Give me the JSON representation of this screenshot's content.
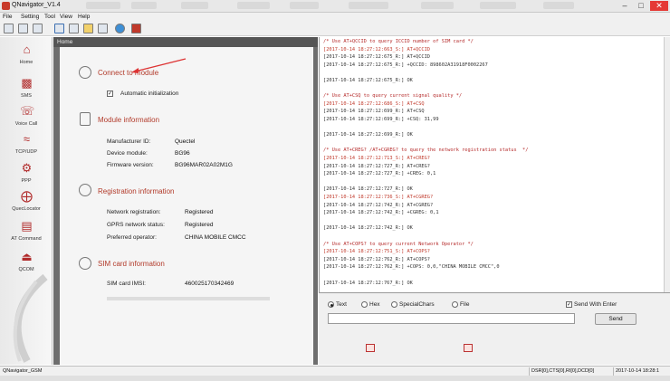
{
  "window": {
    "title": "QNavigator_V1.4"
  },
  "menu": [
    "File",
    "Setting",
    "Tool",
    "View",
    "Help"
  ],
  "sidebar": {
    "items": [
      {
        "label": "Home",
        "icon": "home-icon"
      },
      {
        "label": "SMS",
        "icon": "sms-icon"
      },
      {
        "label": "Voice Call",
        "icon": "phone-icon"
      },
      {
        "label": "TCP/UDP",
        "icon": "wifi-icon"
      },
      {
        "label": "PPP",
        "icon": "ppp-icon"
      },
      {
        "label": "QuecLocator",
        "icon": "locator-icon"
      },
      {
        "label": "AT Command",
        "icon": "at-command-icon"
      },
      {
        "label": "QCOM",
        "icon": "qcom-icon"
      }
    ]
  },
  "home": {
    "header": "Home",
    "connect": {
      "title": "Connect to module",
      "auto_init_label": "Automatic initialization",
      "auto_init": true
    },
    "module_info": {
      "title": "Module information",
      "rows": [
        {
          "label": "Manufacturer ID:",
          "value": "Quectel"
        },
        {
          "label": "Device module:",
          "value": "BG96"
        },
        {
          "label": "Firmware version:",
          "value": "BG96MAR02A02M1G"
        }
      ]
    },
    "registration": {
      "title": "Registration information",
      "rows": [
        {
          "label": "Network registration:",
          "value": "Registered"
        },
        {
          "label": "GPRS network status:",
          "value": "Registered"
        },
        {
          "label": "Preferred operator:",
          "value": "CHINA MOBILE CMCC"
        }
      ]
    },
    "sim": {
      "title": "SIM card information",
      "rows": [
        {
          "label": "SIM card IMSI:",
          "value": "460025170342469"
        }
      ]
    }
  },
  "log": [
    {
      "t": "c",
      "text": "/* Use AT+QCCID to query ICCID number of SIM card */"
    },
    {
      "t": "s",
      "text": "[2017-10-14 18:27:12:663_S:] AT+QCCID"
    },
    {
      "t": "r",
      "text": "[2017-10-14 18:27:12:675_R:] AT+QCCID"
    },
    {
      "t": "r",
      "text": "[2017-10-14 18:27:12:675_R:] +QCCID: 898602A31918F0002267"
    },
    {
      "t": "r",
      "text": ""
    },
    {
      "t": "r",
      "text": "[2017-10-14 18:27:12:675_R:] OK"
    },
    {
      "t": "r",
      "text": ""
    },
    {
      "t": "c",
      "text": "/* Use AT+CSQ to query current signal quality */"
    },
    {
      "t": "s",
      "text": "[2017-10-14 18:27:12:686_S:] AT+CSQ"
    },
    {
      "t": "r",
      "text": "[2017-10-14 18:27:12:699_R:] AT+CSQ"
    },
    {
      "t": "r",
      "text": "[2017-10-14 18:27:12:699_R:] +CSQ: 31,99"
    },
    {
      "t": "r",
      "text": ""
    },
    {
      "t": "r",
      "text": "[2017-10-14 18:27:12:699_R:] OK"
    },
    {
      "t": "r",
      "text": ""
    },
    {
      "t": "c",
      "text": "/* Use AT+CREG? /AT+CGREG? to query the network registration status  */"
    },
    {
      "t": "s",
      "text": "[2017-10-14 18:27:12:713_S:] AT+CREG?"
    },
    {
      "t": "r",
      "text": "[2017-10-14 18:27:12:727_R:] AT+CREG?"
    },
    {
      "t": "r",
      "text": "[2017-10-14 18:27:12:727_R:] +CREG: 0,1"
    },
    {
      "t": "r",
      "text": ""
    },
    {
      "t": "r",
      "text": "[2017-10-14 18:27:12:727_R:] OK"
    },
    {
      "t": "s",
      "text": "[2017-10-14 18:27:12:736_S:] AT+CGREG?"
    },
    {
      "t": "r",
      "text": "[2017-10-14 18:27:12:742_R:] AT+CGREG?"
    },
    {
      "t": "r",
      "text": "[2017-10-14 18:27:12:742_R:] +CGREG: 0,1"
    },
    {
      "t": "r",
      "text": ""
    },
    {
      "t": "r",
      "text": "[2017-10-14 18:27:12:742_R:] OK"
    },
    {
      "t": "r",
      "text": ""
    },
    {
      "t": "c",
      "text": "/* Use AT+COPS? to query current Network Operator */"
    },
    {
      "t": "s",
      "text": "[2017-10-14 18:27:12:751_S:] AT+COPS?"
    },
    {
      "t": "r",
      "text": "[2017-10-14 18:27:12:762_R:] AT+COPS?"
    },
    {
      "t": "r",
      "text": "[2017-10-14 18:27:12:762_R:] +COPS: 0,0,\"CHINA MOBILE CMCC\",0"
    },
    {
      "t": "r",
      "text": ""
    },
    {
      "t": "r",
      "text": "[2017-10-14 18:27:12:767_R:] OK"
    }
  ],
  "send": {
    "modes": [
      {
        "label": "Text",
        "selected": true
      },
      {
        "label": "Hex",
        "selected": false
      },
      {
        "label": "SpecialChars",
        "selected": false
      },
      {
        "label": "File",
        "selected": false
      }
    ],
    "send_with_enter_label": "Send With Enter",
    "send_with_enter": true,
    "input_value": "",
    "send_label": "Send"
  },
  "status": {
    "left": "QNavigator_GSM",
    "signals": "DSR[0],CTS[0],RI[0],DCD[0]",
    "datetime": "2017-10-14 18:28:1"
  },
  "colors": {
    "accent": "#b23b2b",
    "panel_gray": "#6e6e6e"
  }
}
